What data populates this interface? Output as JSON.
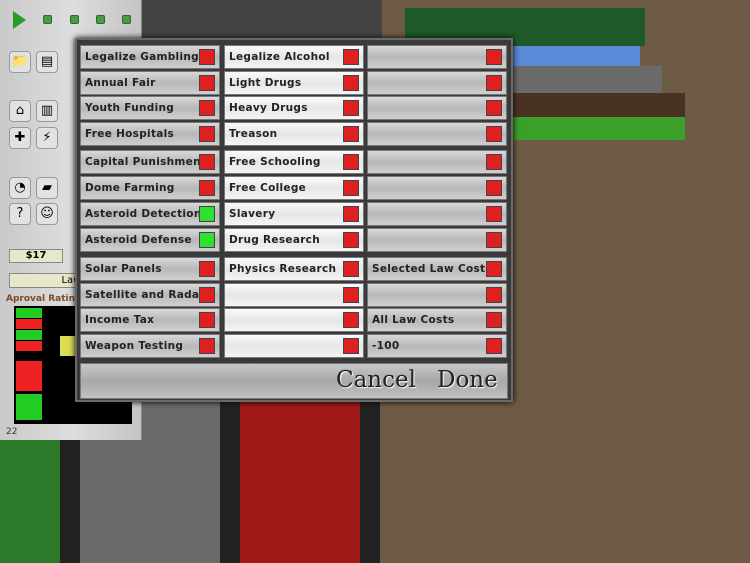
{
  "sidebar": {
    "money": "$17",
    "laws_button": "Laws",
    "approval_label": "Aproval Rating",
    "count": "22"
  },
  "dialog": {
    "columns": [
      [
        {
          "label": "Legalize Gambling",
          "on": false
        },
        {
          "label": "Annual Fair",
          "on": false
        },
        {
          "label": "Youth Funding",
          "on": false
        },
        {
          "label": "Free Hospitals",
          "on": false
        },
        {
          "label": "Capital Punishment",
          "on": false
        },
        {
          "label": "Dome Farming",
          "on": false
        },
        {
          "label": "Asteroid Detection",
          "on": true
        },
        {
          "label": "Asteroid Defense",
          "on": true
        },
        {
          "label": "Solar Panels",
          "on": false
        },
        {
          "label": "Satellite and Radar",
          "on": false
        },
        {
          "label": "Income Tax",
          "on": false
        },
        {
          "label": "Weapon Testing",
          "on": false
        }
      ],
      [
        {
          "label": "Legalize Alcohol",
          "on": false
        },
        {
          "label": "Light Drugs",
          "on": false
        },
        {
          "label": "Heavy Drugs",
          "on": false
        },
        {
          "label": "Treason",
          "on": false
        },
        {
          "label": "Free Schooling",
          "on": false
        },
        {
          "label": "Free College",
          "on": false
        },
        {
          "label": "Slavery",
          "on": false
        },
        {
          "label": "Drug Research",
          "on": false
        },
        {
          "label": "Physics Research",
          "on": false
        },
        {
          "label": "",
          "on": false
        },
        {
          "label": "",
          "on": false
        },
        {
          "label": "",
          "on": false
        }
      ],
      [
        {
          "label": "",
          "on": false
        },
        {
          "label": "",
          "on": false
        },
        {
          "label": "",
          "on": false
        },
        {
          "label": "",
          "on": false
        },
        {
          "label": "",
          "on": false
        },
        {
          "label": "",
          "on": false
        },
        {
          "label": "",
          "on": false
        },
        {
          "label": "",
          "on": false
        },
        {
          "label": "Selected Law Cost",
          "on": false
        },
        {
          "label": "",
          "on": false
        },
        {
          "label": "All Law Costs",
          "on": false
        },
        {
          "label": "-100",
          "on": false
        }
      ]
    ],
    "cancel": "Cancel",
    "done": "Done"
  },
  "colors": {
    "off": "#e02020",
    "on": "#30e030"
  }
}
